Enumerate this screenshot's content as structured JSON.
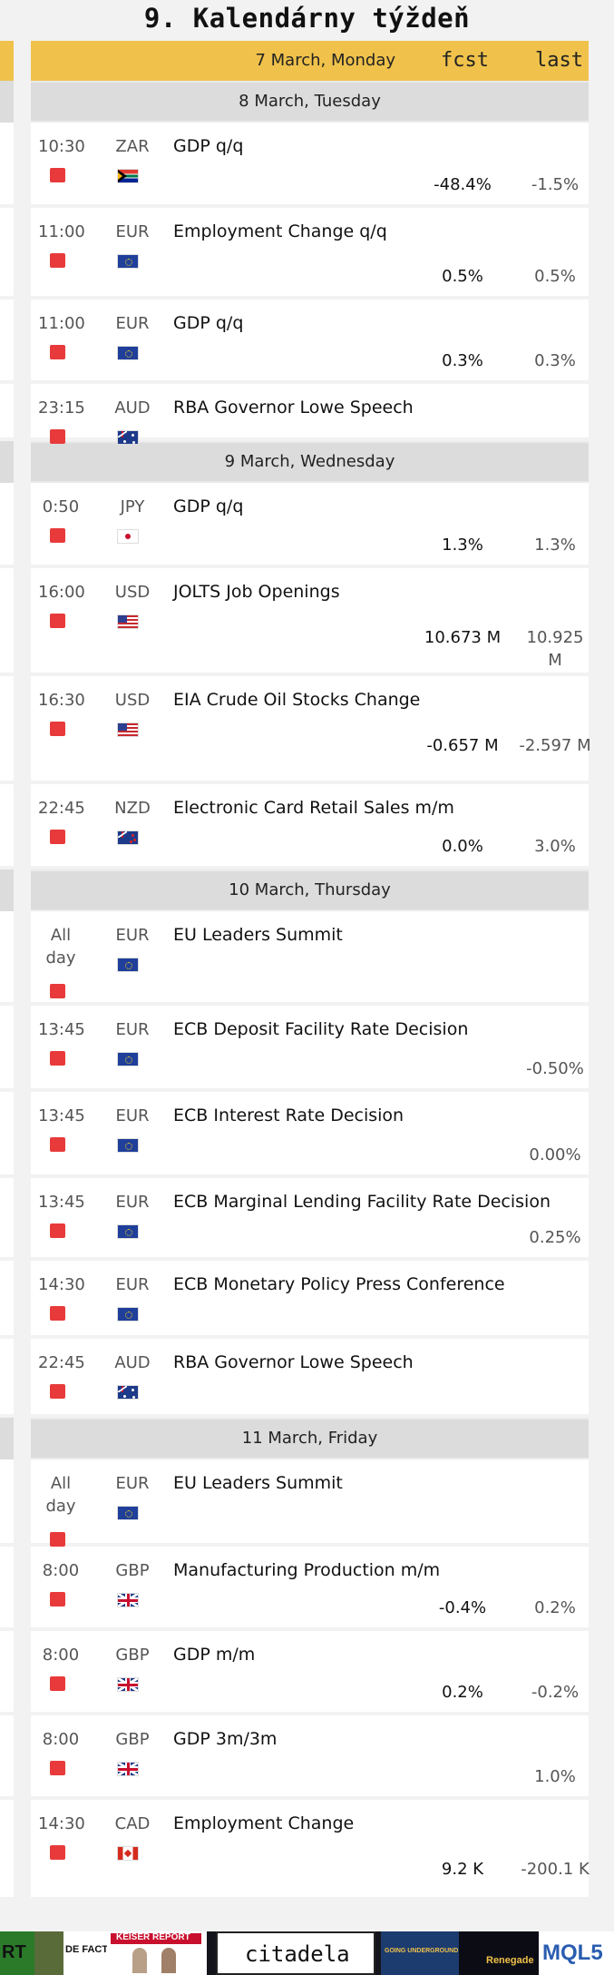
{
  "page_title": "9. Kalendárny týždeň",
  "header": {
    "date": "7 March, Monday",
    "fcst_label": "fcst",
    "last_label": "last"
  },
  "days": [
    {
      "label": "8 March, Tuesday",
      "events": [
        {
          "time": "10:30",
          "currency": "ZAR",
          "flag": "zar-flag-icon",
          "name": "GDP q/q",
          "fcst": "-48.4%",
          "last": "-1.5%"
        },
        {
          "time": "11:00",
          "currency": "EUR",
          "flag": "eur-flag-icon",
          "name": "Employment Change q/q",
          "fcst": "0.5%",
          "last": "0.5%"
        },
        {
          "time": "11:00",
          "currency": "EUR",
          "flag": "eur-flag-icon",
          "name": "GDP q/q",
          "fcst": "0.3%",
          "last": "0.3%"
        },
        {
          "time": "23:15",
          "currency": "AUD",
          "flag": "aud-flag-icon",
          "name": "RBA Governor Lowe Speech",
          "fcst": "",
          "last": ""
        }
      ]
    },
    {
      "label": "9 March, Wednesday",
      "events": [
        {
          "time": "0:50",
          "currency": "JPY",
          "flag": "jpy-flag-icon",
          "name": "GDP q/q",
          "fcst": "1.3%",
          "last": "1.3%"
        },
        {
          "time": "16:00",
          "currency": "USD",
          "flag": "usd-flag-icon",
          "name": "JOLTS Job Openings",
          "fcst": "10.673 M",
          "last": "10.925 M"
        },
        {
          "time": "16:30",
          "currency": "USD",
          "flag": "usd-flag-icon",
          "name": "EIA Crude Oil Stocks Change",
          "fcst": "-0.657 M",
          "last": "-2.597 M"
        },
        {
          "time": "22:45",
          "currency": "NZD",
          "flag": "nzd-flag-icon",
          "name": "Electronic Card Retail Sales m/m",
          "fcst": "0.0%",
          "last": "3.0%"
        }
      ]
    },
    {
      "label": "10 March, Thursday",
      "events": [
        {
          "time": "All day",
          "currency": "EUR",
          "flag": "eur-flag-icon",
          "name": "EU Leaders Summit",
          "fcst": "",
          "last": ""
        },
        {
          "time": "13:45",
          "currency": "EUR",
          "flag": "eur-flag-icon",
          "name": "ECB Deposit Facility Rate Decision",
          "fcst": "",
          "last": "-0.50%"
        },
        {
          "time": "13:45",
          "currency": "EUR",
          "flag": "eur-flag-icon",
          "name": "ECB Interest Rate Decision",
          "fcst": "",
          "last": "0.00%"
        },
        {
          "time": "13:45",
          "currency": "EUR",
          "flag": "eur-flag-icon",
          "name": "ECB Marginal Lending Facility Rate Decision",
          "fcst": "",
          "last": "0.25%"
        },
        {
          "time": "14:30",
          "currency": "EUR",
          "flag": "eur-flag-icon",
          "name": "ECB Monetary Policy Press Conference",
          "fcst": "",
          "last": ""
        },
        {
          "time": "22:45",
          "currency": "AUD",
          "flag": "aud-flag-icon",
          "name": "RBA Governor Lowe Speech",
          "fcst": "",
          "last": ""
        }
      ]
    },
    {
      "label": "11 March, Friday",
      "events": [
        {
          "time": "All day",
          "currency": "EUR",
          "flag": "eur-flag-icon",
          "name": "EU Leaders Summit",
          "fcst": "",
          "last": ""
        },
        {
          "time": "8:00",
          "currency": "GBP",
          "flag": "gbp-flag-icon",
          "name": "Manufacturing Production m/m",
          "fcst": "-0.4%",
          "last": "0.2%"
        },
        {
          "time": "8:00",
          "currency": "GBP",
          "flag": "gbp-flag-icon",
          "name": "GDP m/m",
          "fcst": "0.2%",
          "last": "-0.2%"
        },
        {
          "time": "8:00",
          "currency": "GBP",
          "flag": "gbp-flag-icon",
          "name": "GDP 3m/3m",
          "fcst": "",
          "last": "1.0%"
        },
        {
          "time": "14:30",
          "currency": "CAD",
          "flag": "cad-flag-icon",
          "name": "Employment Change",
          "fcst": "9.2 K",
          "last": "-200.1 K"
        }
      ]
    }
  ],
  "colors": {
    "header_bg": "#f0c24b",
    "day_header_bg": "#dcdcdc",
    "importance_high": "#e83a3a",
    "page_bg": "#f2f2f2"
  },
  "footer_ads": [
    {
      "label": "RT",
      "icon": "rt-logo-icon"
    },
    {
      "label": "DE FACTO",
      "icon": "defacto-logo-icon"
    },
    {
      "label": "KEISER REPORT",
      "icon": "keiser-report-logo-icon"
    },
    {
      "label": "citadela",
      "icon": "citadela-logo-icon"
    },
    {
      "label": "GOING UNDERGROUND",
      "icon": "going-underground-logo-icon"
    },
    {
      "label": "Renegade",
      "icon": "renegade-logo-icon"
    },
    {
      "label": "MQL5",
      "icon": "mql5-logo-icon"
    }
  ]
}
